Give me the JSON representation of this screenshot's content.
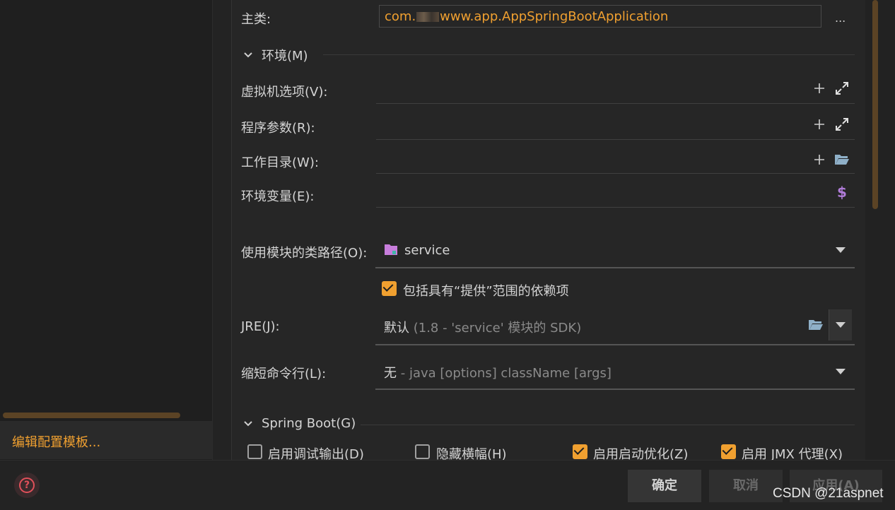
{
  "sidebar": {
    "edit_templates_label": "编辑配置模板..."
  },
  "main_class": {
    "label": "主类:",
    "value_prefix": "com.",
    "value_suffix": "www.app.AppSpringBootApplication",
    "browse_label": "..."
  },
  "environment": {
    "title": "环境(M)",
    "vm_options_label": "虚拟机选项(V):",
    "program_args_label": "程序参数(R):",
    "working_dir_label": "工作目录(W):",
    "env_vars_label": "环境变量(E):",
    "env_vars_icon": "$"
  },
  "module_classpath": {
    "label": "使用模块的类路径(O):",
    "value": "service"
  },
  "include_provided": {
    "label": "包括具有“提供”范围的依赖项",
    "checked": true
  },
  "jre": {
    "label": "JRE(J):",
    "value": "默认",
    "hint": " (1.8 - 'service' 模块的 SDK)"
  },
  "shorten_cmd": {
    "label": "缩短命令行(L):",
    "value": "无",
    "hint": " - java [options] className [args]"
  },
  "spring_boot": {
    "title": "Spring Boot(G)",
    "options": [
      {
        "label": "启用调试输出(D)",
        "checked": false
      },
      {
        "label": "隐藏横幅(H)",
        "checked": false
      },
      {
        "label": "启用启动优化(Z)",
        "checked": true
      },
      {
        "label": "启用 JMX 代理(X)",
        "checked": true
      }
    ]
  },
  "footer": {
    "ok_label": "确定",
    "cancel_label": "取消",
    "apply_label": "应用(A)",
    "watermark": "CSDN @21aspnet"
  },
  "colors": {
    "accent": "#f0a030",
    "background": "#262626",
    "help": "#e0505a",
    "folder_purple": "#c77ddb"
  }
}
